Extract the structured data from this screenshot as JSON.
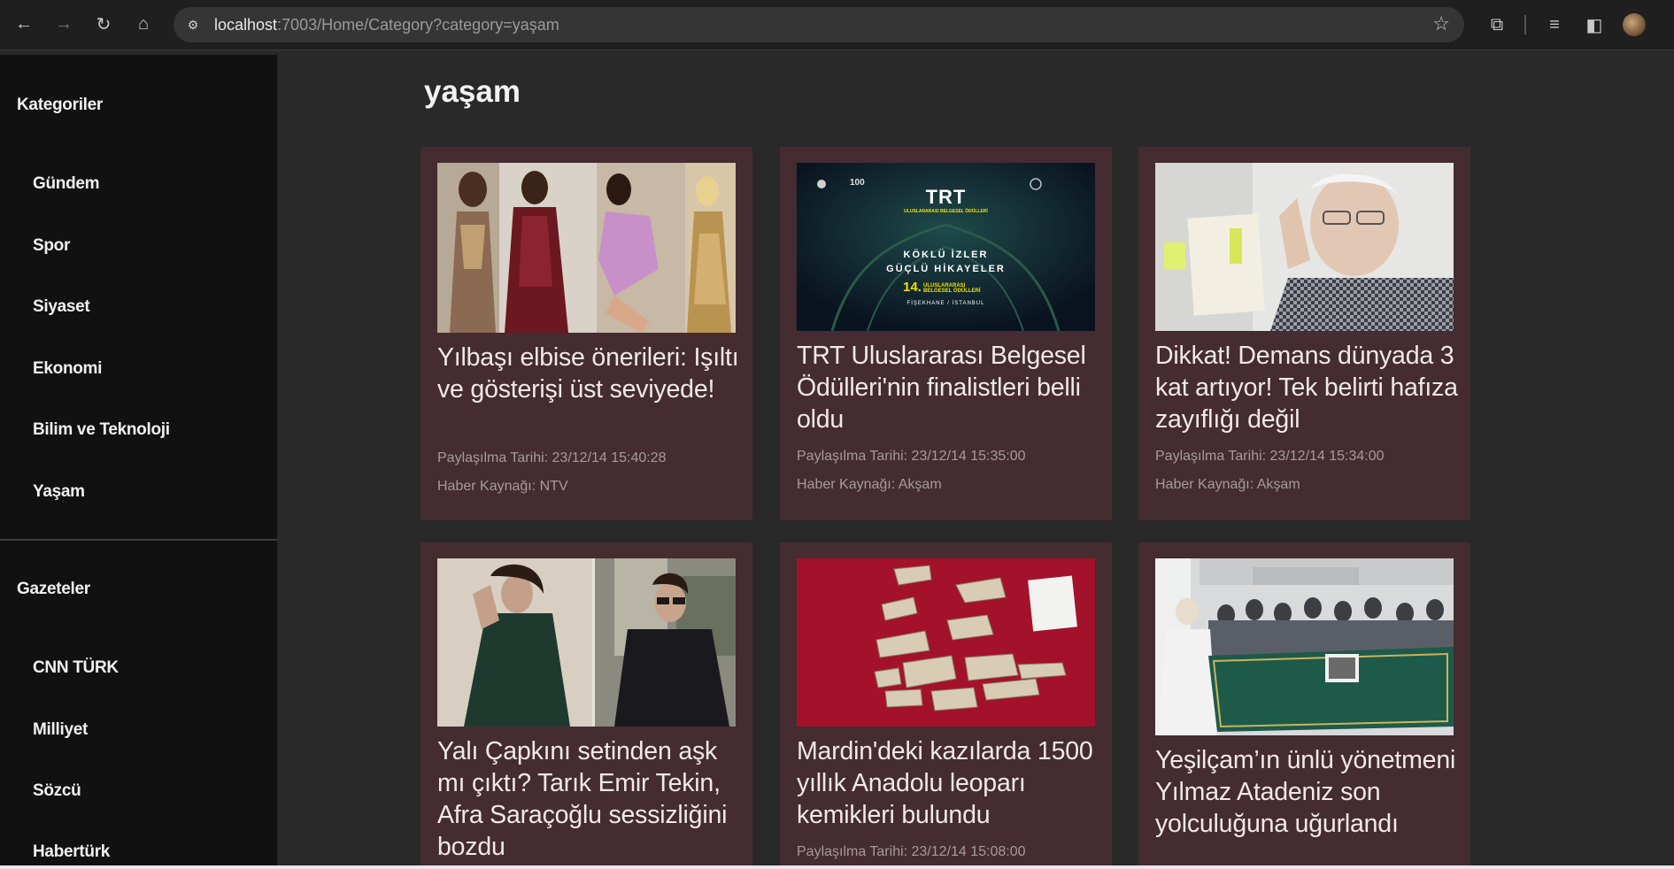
{
  "browser": {
    "url_host": "localhost",
    "url_rest": ":7003/Home/Category?category=yaşam"
  },
  "sidebar": {
    "categories_heading": "Kategoriler",
    "categories": [
      "Gündem",
      "Spor",
      "Siyaset",
      "Ekonomi",
      "Bilim ve Teknoloji",
      "Yaşam"
    ],
    "newspapers_heading": "Gazeteler",
    "newspapers": [
      "CNN TÜRK",
      "Milliyet",
      "Sözcü",
      "Habertürk"
    ]
  },
  "main": {
    "title": "yaşam",
    "cards": [
      {
        "headline": "Yılbaşı elbise önerileri: Işıltı ve gösterişi üst seviyede!",
        "date": "Paylaşılma Tarihi: 23/12/14 15:40:28",
        "source": "Haber Kaynağı: NTV"
      },
      {
        "headline": "TRT Uluslararası Belgesel Ödülleri'nin finalistleri belli oldu",
        "date": "Paylaşılma Tarihi: 23/12/14 15:35:00",
        "source": "Haber Kaynağı: Akşam",
        "image_text": {
          "logo": "TRT",
          "sub": "ULUSLARARASI BELGESEL ÖDÜLLERİ",
          "line1": "KÖKLÜ İZLER",
          "line2": "GÜÇLÜ HİKAYELER",
          "edition": "14.",
          "edition_sub": "ULUSLARARASI BELGESEL ÖDÜLLERİ",
          "venue": "FİŞEKHANE / İSTANBUL"
        }
      },
      {
        "headline": "Dikkat! Demans dünyada 3 kat artıyor! Tek belirti hafıza zayıflığı değil",
        "date": "Paylaşılma Tarihi: 23/12/14 15:34:00",
        "source": "Haber Kaynağı: Akşam"
      },
      {
        "headline": "Yalı Çapkını setinden aşk mı çıktı? Tarık Emir Tekin, Afra Saraçoğlu sessizliğini bozdu",
        "date": "",
        "source": ""
      },
      {
        "headline": "Mardin'deki kazılarda 1500 yıllık Anadolu leoparı kemikleri bulundu",
        "date": "Paylaşılma Tarihi: 23/12/14 15:08:00",
        "source": ""
      },
      {
        "headline": "Yeşilçam’ın ünlü yönetmeni Yılmaz Atadeniz son yolculuğuna uğurlandı",
        "date": "",
        "source": ""
      }
    ]
  }
}
